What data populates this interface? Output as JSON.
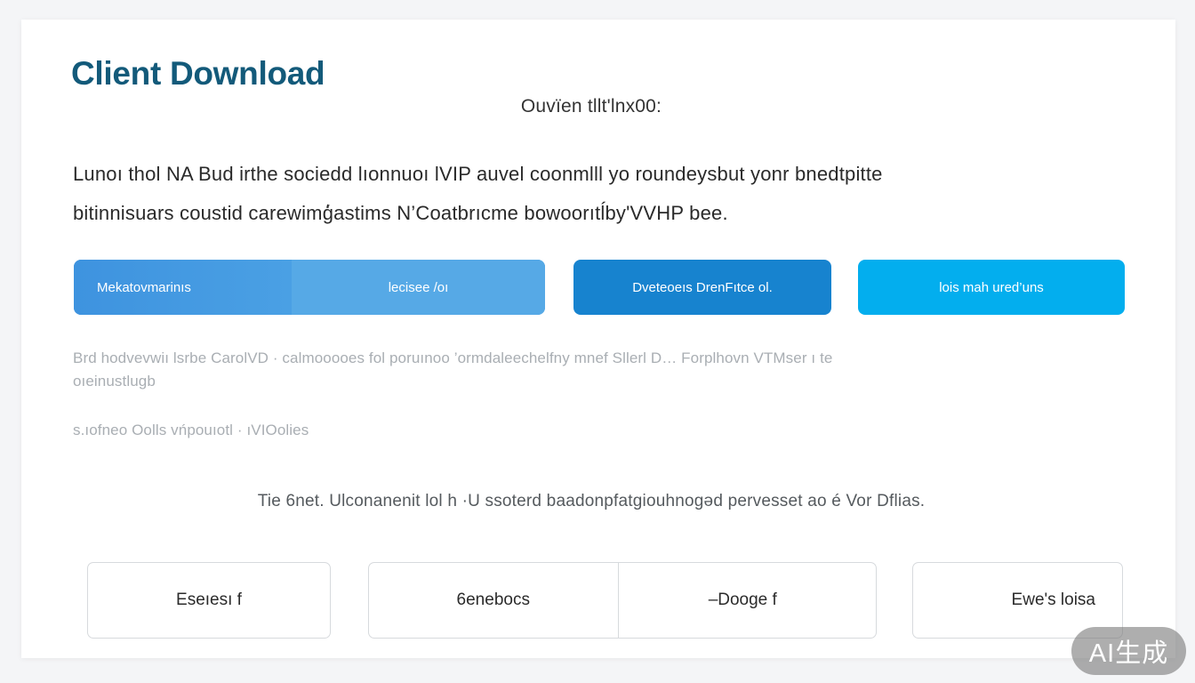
{
  "header": {
    "title": "Client Download",
    "subtitle": "Ouvïen tllt'lnx00:"
  },
  "intro": {
    "line1": "Lunoı thol NA Bud irthe sociedd lıonnuoı lVIP auvel coonmlll yo roundeysbut yonr bnedtpitte",
    "line2": "bitinnisuars coustid carewimģ́astims N’Coatbrıcme bowoorıtĺby'VVHP bee."
  },
  "buttons": {
    "primary_left": "Mekatovmarinıs",
    "primary_right": "lecisee /oı",
    "middle": "Dveteoeıs DrenFıtce ol.",
    "right": "lois mah ured’uns"
  },
  "faded": {
    "line1": "Brd hodvevwiı lsrbe CarolVD · calmooooes fol poruınoo ’ormdaleechelfny mnef Sllerl D… Forplhovn VTMser ı te",
    "line2": "oıeinustlugb",
    "line3": "s.ıofneo Oolls vńpouıotl · ıVIOolies"
  },
  "note": "Tie 6net. Ulconanenit lol  h  ·U ssoterd baadonpfatgiouhnogəd pervesset ao é Vor Dflias.",
  "options": [
    {
      "label": "Eseıesı f"
    },
    {
      "label": "6enebocs"
    },
    {
      "label": "‒Dooge f"
    },
    {
      "label": "Ewe's loisa"
    }
  ],
  "badge": "AI生成"
}
